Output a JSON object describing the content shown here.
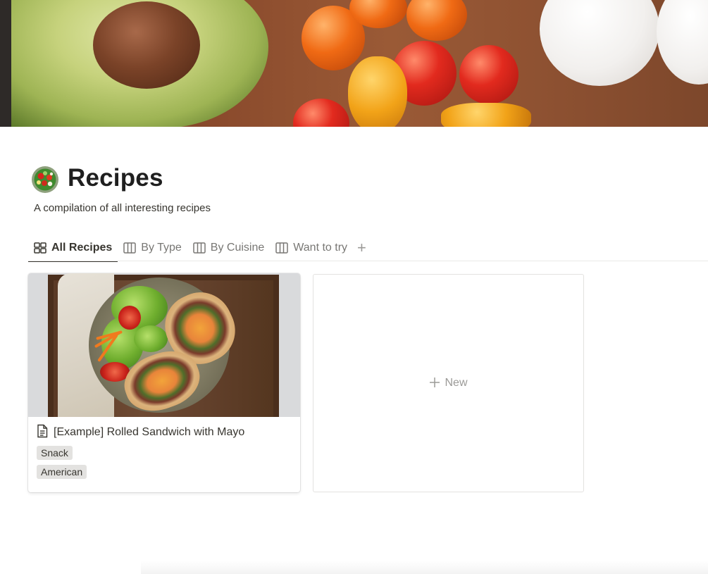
{
  "page": {
    "title": "Recipes",
    "description": "A compilation of all interesting recipes",
    "icon": "salad-bowl-icon"
  },
  "tabs": [
    {
      "label": "All Recipes",
      "icon": "gallery-grid-icon",
      "active": true
    },
    {
      "label": "By Type",
      "icon": "board-columns-icon",
      "active": false
    },
    {
      "label": "By Cuisine",
      "icon": "board-columns-icon",
      "active": false
    },
    {
      "label": "Want to try",
      "icon": "board-columns-icon",
      "active": false
    }
  ],
  "add_view_label": "+",
  "gallery": {
    "cards": [
      {
        "title": "[Example] Rolled Sandwich with Mayo",
        "icon": "document-icon",
        "tags": [
          "Snack",
          "American"
        ]
      }
    ],
    "new_label": "New"
  },
  "colors": {
    "text": "#37352f",
    "muted": "#787774",
    "tag_bg": "#e3e2e0",
    "border": "#e9e9e7"
  }
}
